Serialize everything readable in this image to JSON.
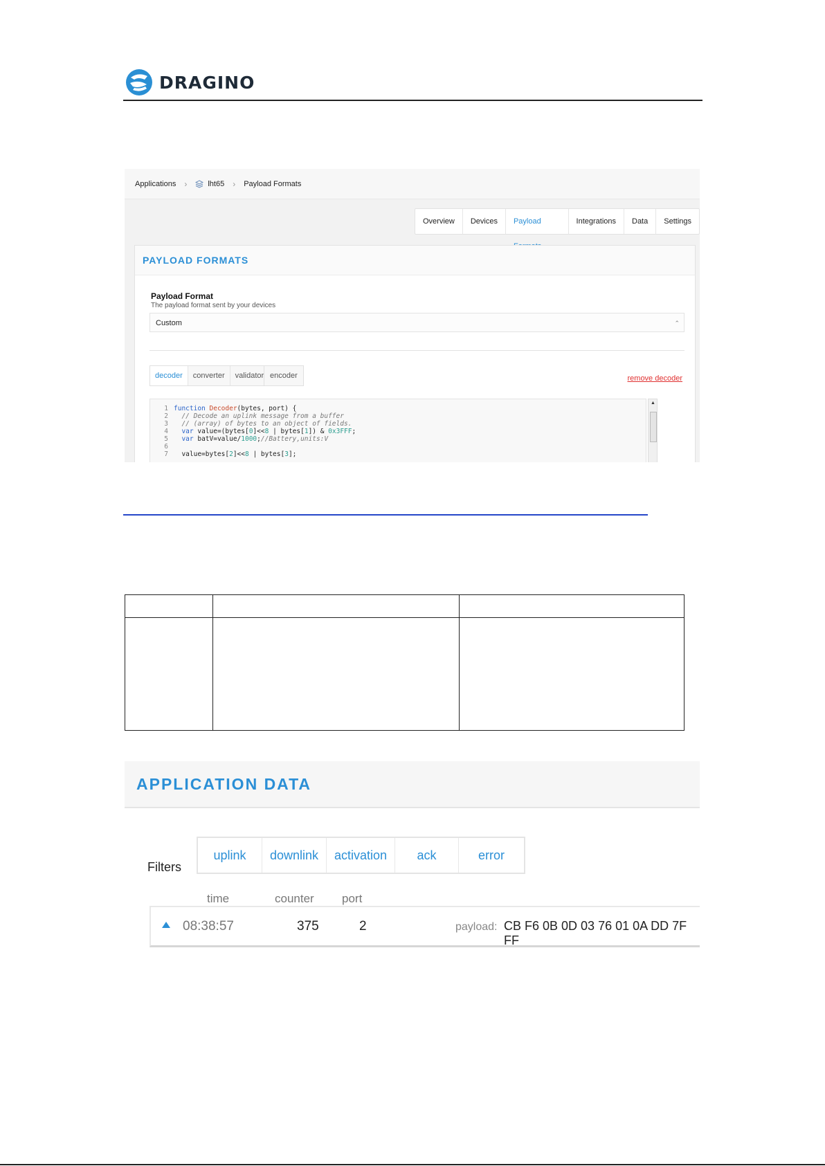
{
  "header": {
    "logo_text": "DRAGINO"
  },
  "screenshot1": {
    "breadcrumb": [
      "Applications",
      "lht65",
      "Payload Formats"
    ],
    "tabs": [
      {
        "label": "Overview",
        "active": false
      },
      {
        "label": "Devices",
        "active": false
      },
      {
        "label": "Payload Formats",
        "active": true
      },
      {
        "label": "Integrations",
        "active": false
      },
      {
        "label": "Data",
        "active": false
      },
      {
        "label": "Settings",
        "active": false
      }
    ],
    "card_title": "PAYLOAD FORMATS",
    "format_label": "Payload Format",
    "format_desc": "The payload format sent by your devices",
    "format_value": "Custom",
    "decoder_tabs": [
      {
        "label": "decoder",
        "active": true
      },
      {
        "label": "converter",
        "active": false
      },
      {
        "label": "validator",
        "active": false
      }
    ],
    "encoder_tab": "encoder",
    "remove_link": "remove decoder",
    "code_lines": [
      {
        "n": "1",
        "html": "<span class='kw'>function</span> <span class='fn'>Decoder</span>(bytes, port) {"
      },
      {
        "n": "2",
        "html": "  <span class='cm'>// Decode an uplink message from a buffer</span>"
      },
      {
        "n": "3",
        "html": "  <span class='cm'>// (array) of bytes to an object of fields.</span>"
      },
      {
        "n": "4",
        "html": "  <span class='kw'>var</span> value=(bytes[<span class='nm'>0</span>]&lt;&lt;<span class='nm'>8</span> | bytes[<span class='nm'>1</span>]) &amp; <span class='nm'>0x3FFF</span>;"
      },
      {
        "n": "5",
        "html": "  <span class='kw'>var</span> batV=value/<span class='nm'>1000</span>;<span class='cm'>//Battery,units:V</span>"
      },
      {
        "n": "6",
        "html": ""
      },
      {
        "n": "7",
        "html": "  value=bytes[<span class='nm'>2</span>]&lt;&lt;<span class='nm'>8</span> | bytes[<span class='nm'>3</span>];"
      }
    ]
  },
  "screenshot2": {
    "title": "APPLICATION DATA",
    "filters_label": "Filters",
    "filter_tabs": [
      "uplink",
      "downlink",
      "activation",
      "ack",
      "error"
    ],
    "columns": [
      "time",
      "counter",
      "port"
    ],
    "row": {
      "time": "08:38:57",
      "counter": "375",
      "port": "2",
      "payload_label": "payload:",
      "payload": "CB F6 0B 0D 03 76 01 0A DD 7F FF"
    }
  },
  "colors": {
    "accent": "#2b8fd6",
    "danger": "#e03030",
    "link_rule": "#2546c9"
  }
}
